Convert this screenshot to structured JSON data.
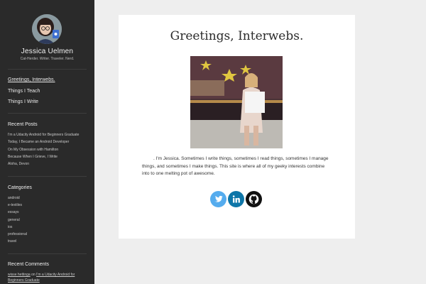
{
  "sidebar": {
    "site_title": "Jessica Uelmen",
    "site_description": "Cat-Herder. Writer. Traveler. Nerd.",
    "nav": [
      {
        "label": "Greetings, Interwebs.",
        "active": true
      },
      {
        "label": "Things I Teach",
        "active": false
      },
      {
        "label": "Things I Write",
        "active": false
      }
    ],
    "recent_posts": {
      "title": "Recent Posts",
      "items": [
        "I'm a Udacity Android for Beginners Graduate",
        "Today, I Became an Android Developer",
        "On My Obsession with Hamilton",
        "Because When I Grieve, I Write",
        "Aloha, Devon"
      ]
    },
    "categories": {
      "title": "Categories",
      "items": [
        "android",
        "e-textiles",
        "essays",
        "general",
        "ios",
        "professional",
        "travel"
      ]
    },
    "recent_comments": {
      "title": "Recent Comments",
      "author": "wisse hettinga",
      "on": "on",
      "post_line1": "I'm a Udacity Android for",
      "post_line2": "Beginners Graduate"
    }
  },
  "main": {
    "title": "Greetings, Interwebs.",
    "intro_line1": ". I'm Jessica. Sometimes I write things, sometimes I read things, sometimes I manage",
    "intro_line2": "things, and sometimes I make things. This site is where all of my geeky interests combine",
    "intro_line3": "into to one melting pot of awesome.",
    "social": [
      {
        "icon": "twitter-icon",
        "color": "#55acee"
      },
      {
        "icon": "linkedin-icon",
        "color": "#0e76a8"
      },
      {
        "icon": "github-icon",
        "color": "#111111"
      }
    ]
  },
  "colors": {
    "sidebar_bg": "#2a2a2a",
    "page_bg": "#eeeeee",
    "card_bg": "#ffffff"
  }
}
